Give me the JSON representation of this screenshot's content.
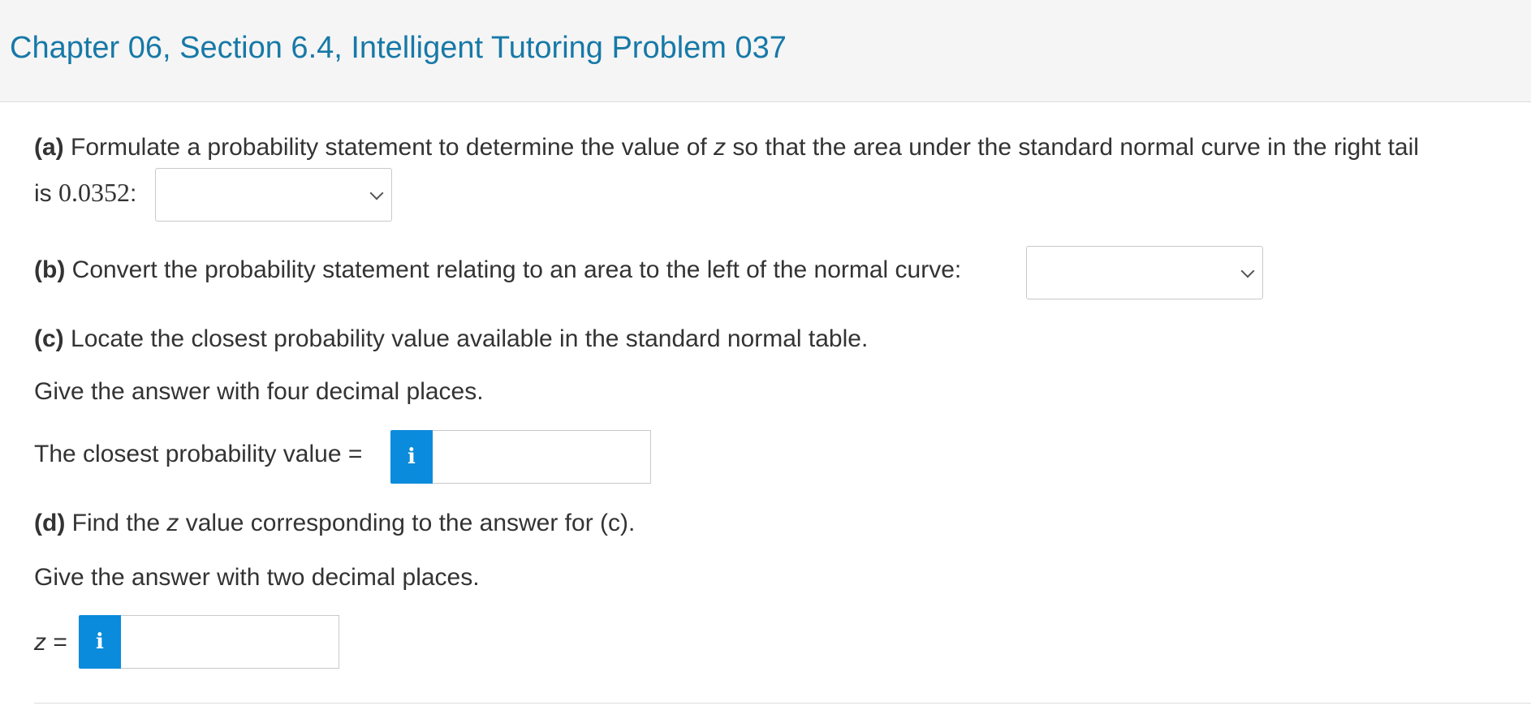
{
  "header": {
    "title": "Chapter 06, Section 6.4, Intelligent Tutoring Problem 037"
  },
  "part_a": {
    "label": "(a)",
    "text_before_var": " Formulate a probability statement to determine the value of ",
    "var": "z",
    "text_after_var": " so that the area under the standard normal curve in the right tail",
    "line2_prefix": "is ",
    "value": "0.0352",
    "suffix": ":",
    "dropdown_value": ""
  },
  "part_b": {
    "label": "(b)",
    "text": " Convert the probability statement relating to an area to the left of the normal curve:",
    "dropdown_value": ""
  },
  "part_c": {
    "label": "(c)",
    "text": " Locate the closest probability value available in the standard normal table.",
    "instruction": "Give the answer with four decimal places.",
    "answer_label": "The closest probability value =",
    "answer_value": "",
    "info_glyph": "i"
  },
  "part_d": {
    "label": "(d)",
    "text_before_var": " Find the ",
    "var": "z",
    "text_after_var": " value corresponding to the answer for (c).",
    "instruction": "Give the answer with two decimal places.",
    "answer_var": "z",
    "answer_eq": " =",
    "answer_value": "",
    "info_glyph": "i"
  }
}
